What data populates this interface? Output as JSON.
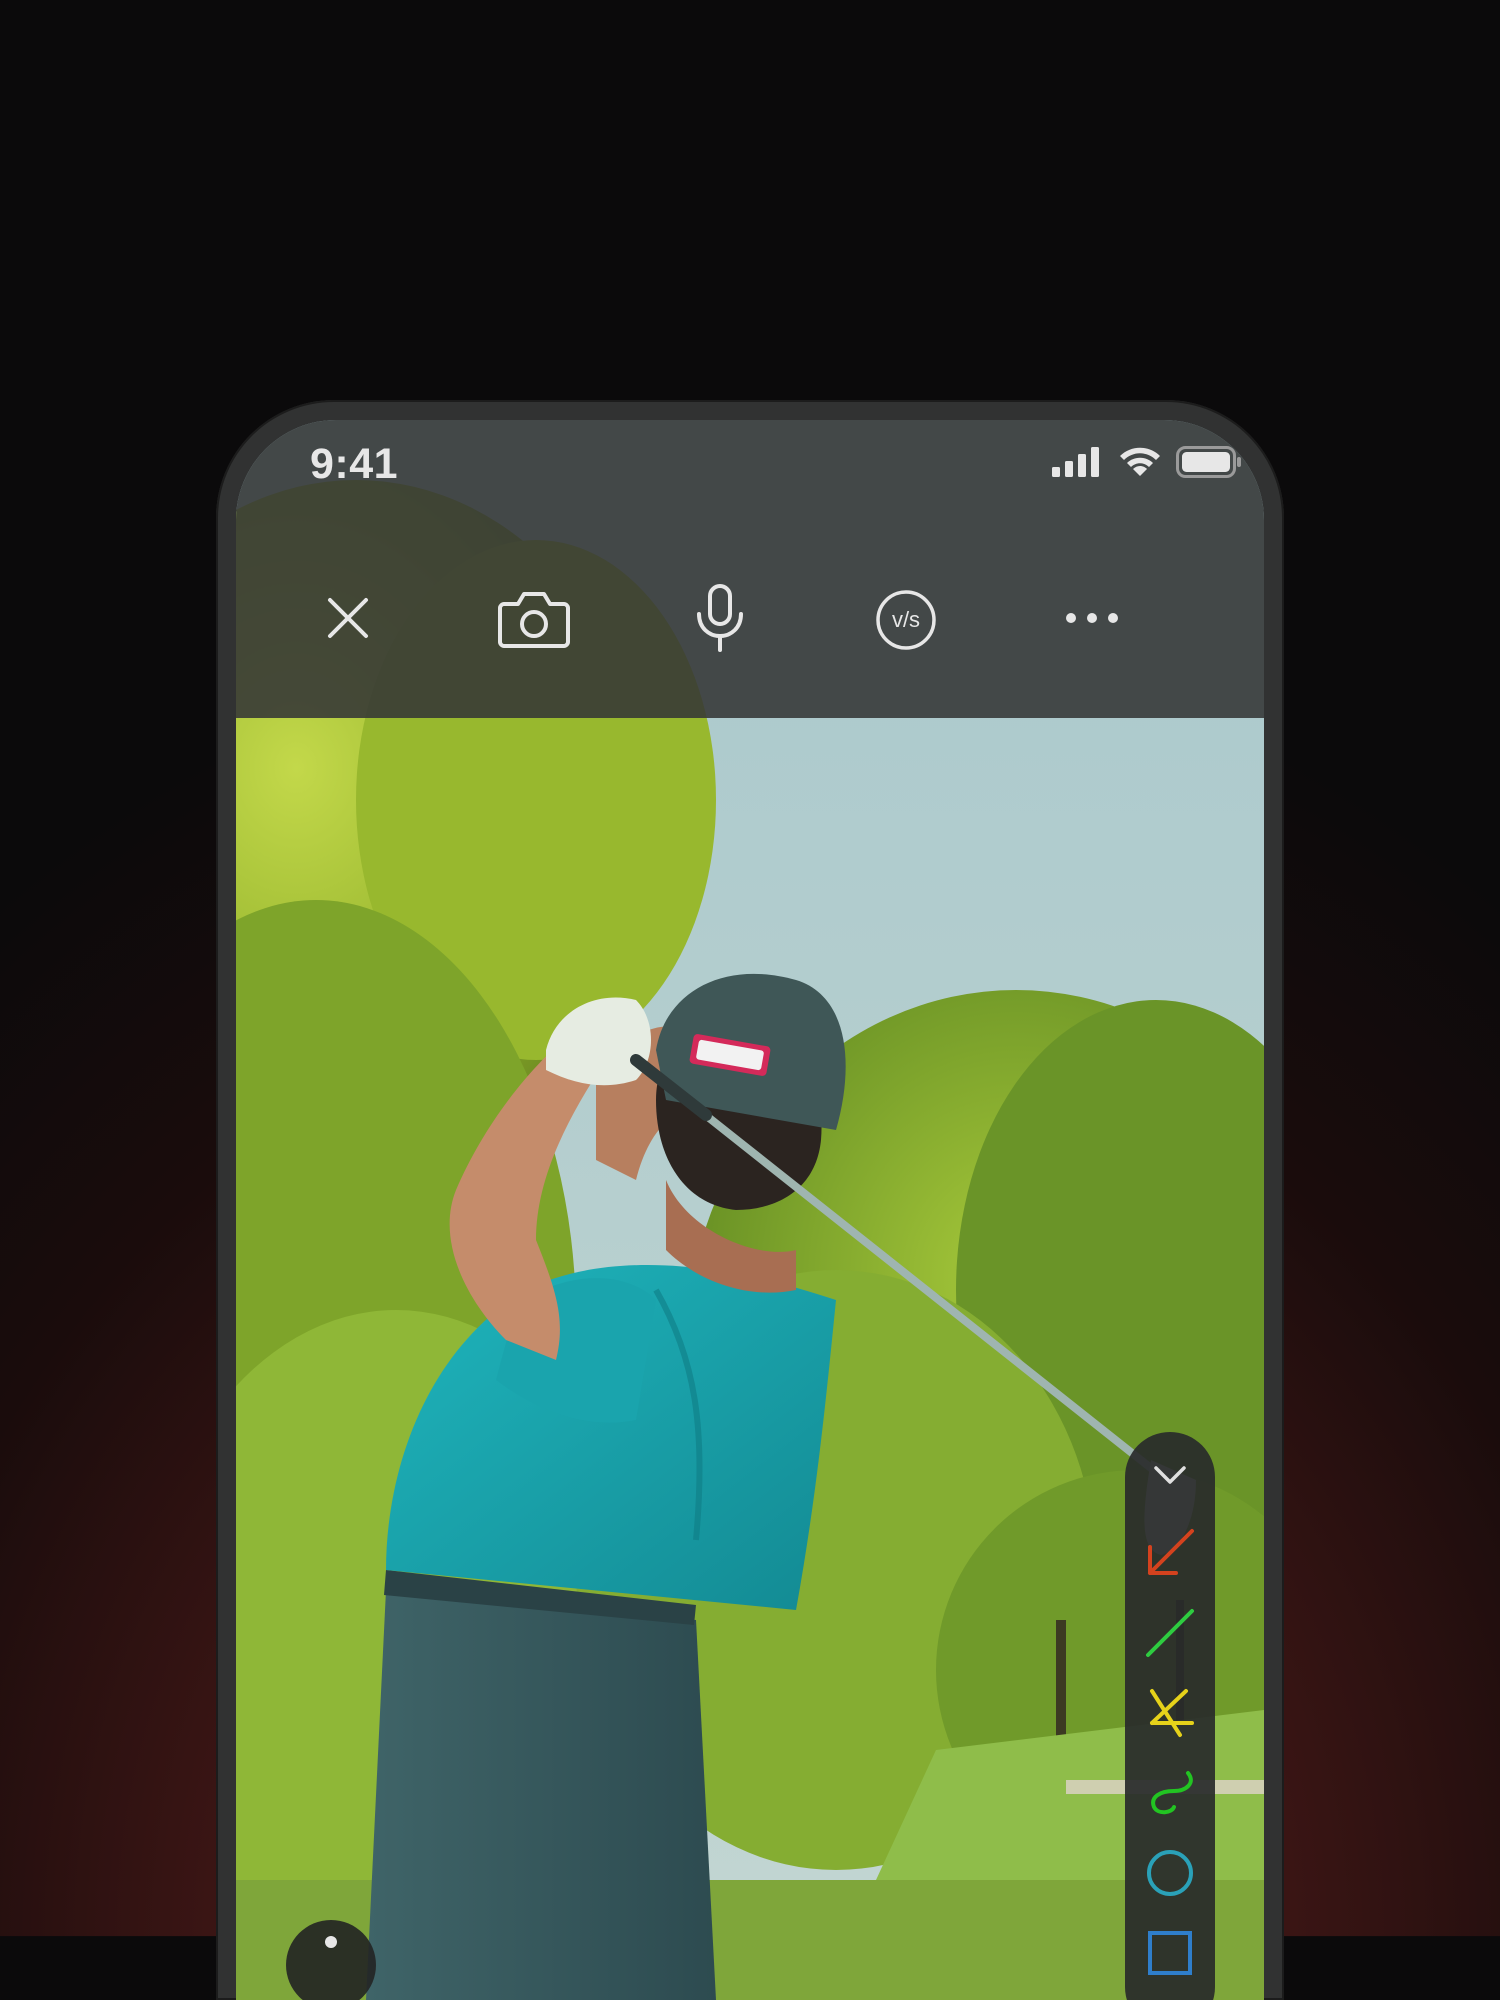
{
  "status_bar": {
    "time": "9:41",
    "icons": [
      "signal-icon",
      "wifi-icon",
      "battery-icon"
    ]
  },
  "toolbar": {
    "items": [
      {
        "name": "close",
        "icon": "close-icon"
      },
      {
        "name": "camera",
        "icon": "camera-icon"
      },
      {
        "name": "microphone",
        "icon": "microphone-icon"
      },
      {
        "name": "versus",
        "icon": "vs-icon",
        "label": "v/s"
      },
      {
        "name": "more",
        "icon": "more-icon"
      }
    ]
  },
  "drawing_tools": {
    "items": [
      {
        "name": "collapse",
        "icon": "chevron-down-icon",
        "color": "#e0e0e0"
      },
      {
        "name": "arrow",
        "icon": "arrow-icon",
        "color": "#d4421e"
      },
      {
        "name": "line",
        "icon": "line-icon",
        "color": "#2ecc40"
      },
      {
        "name": "angle",
        "icon": "angle-icon",
        "color": "#e6d21a"
      },
      {
        "name": "freehand",
        "icon": "squiggle-icon",
        "color": "#22c422"
      },
      {
        "name": "circle",
        "icon": "circle-icon",
        "color": "#2aa1b8"
      },
      {
        "name": "rectangle",
        "icon": "rectangle-icon",
        "color": "#2f7ecb"
      }
    ]
  },
  "colors": {
    "background": "#0b0a0b",
    "glow": "#5a1b1a",
    "toolbar_bg": "#343636",
    "icon": "#e7e7e7"
  }
}
